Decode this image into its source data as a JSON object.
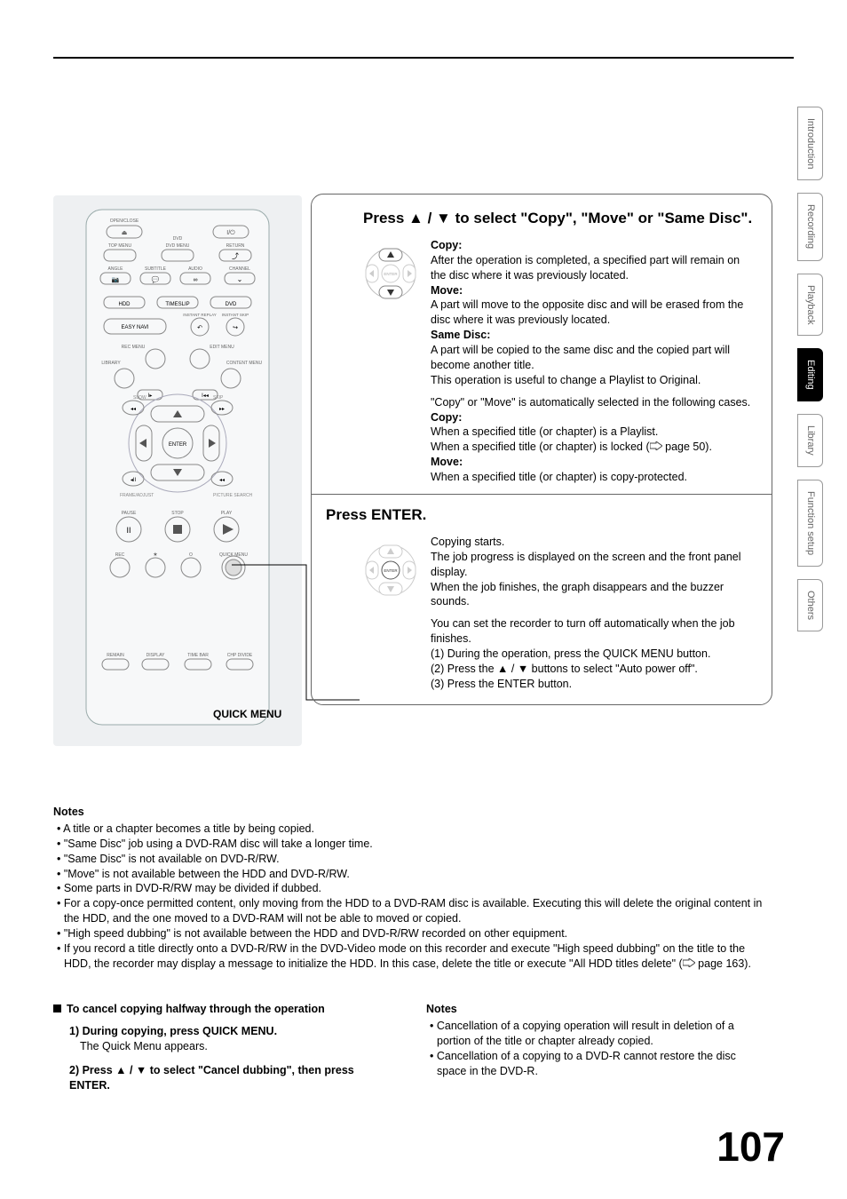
{
  "tabs": {
    "intro": "Introduction",
    "recording": "Recording",
    "playback": "Playback",
    "editing": "Editing",
    "library": "Library",
    "function": "Function setup",
    "others": "Others"
  },
  "remote": {
    "quick_menu_label": "QUICK MENU",
    "buttons": {
      "open_close": "OPEN/CLOSE",
      "power": "I/⏻",
      "top_menu": "TOP MENU",
      "dvd_menu": "DVD MENU",
      "return": "RETURN",
      "angle": "ANGLE",
      "subtitle": "SUBTITLE",
      "audio": "AUDIO",
      "channel": "CHANNEL",
      "hdd": "HDD",
      "timeslip": "TIMESLIP",
      "dvd": "DVD",
      "instant_replay": "INSTANT REPLAY",
      "instant_skip": "INSTANT SKIP",
      "easy_navi": "EASY NAVI",
      "rec_menu": "REC MENU",
      "edit_menu": "EDIT MENU",
      "library": "LIBRARY",
      "content_menu": "CONTENT MENU",
      "enter": "ENTER",
      "slow": "SLOW",
      "skip": "SKIP",
      "frame_adjust": "FRAME/ADJUST",
      "picture_search": "PICTURE SEARCH",
      "pause": "PAUSE",
      "stop": "STOP",
      "play": "PLAY",
      "rec": "REC",
      "star": "★",
      "o": "O",
      "quick_menu": "QUICK MENU",
      "remain": "REMAIN",
      "display": "DISPLAY",
      "time_bar": "TIME BAR",
      "chp_divide": "CHP DIVIDE"
    }
  },
  "step1": {
    "heading_pre": "Press ",
    "heading_mid": " / ",
    "heading_post": " to select \"Copy\", \"Move\" or \"Same Disc\".",
    "copy_lbl": "Copy:",
    "copy_txt": "After the operation is completed, a specified part will remain on the disc where it was previously located.",
    "move_lbl": "Move:",
    "move_txt": "A part will move to the opposite disc and will be erased from the disc where it was previously located.",
    "same_lbl": "Same Disc:",
    "same_txt1": "A part will be copied to the same disc and the copied part will become another title.",
    "same_txt2": "This operation is useful to change a Playlist to Original.",
    "auto_txt": "\"Copy\" or \"Move\" is automatically selected in the following cases.",
    "copy2_lbl": "Copy:",
    "copy2_l1": "When a specified title (or chapter) is a Playlist.",
    "copy2_l2_pre": "When a specified title (or chapter) is locked (",
    "copy2_l2_page": " page 50).",
    "move2_lbl": "Move:",
    "move2_txt": "When a specified title (or chapter) is copy-protected."
  },
  "step2": {
    "heading": "Press ENTER.",
    "p1": "Copying starts.",
    "p2": "The job progress is displayed on the screen and the front panel display.",
    "p3": "When the job finishes, the graph disappears and the buzzer sounds.",
    "p4": "You can set the recorder to turn off automatically when the job finishes.",
    "s1": "(1) During the operation, press the QUICK MENU button.",
    "s2_pre": "(2) Press the ",
    "s2_mid": " / ",
    "s2_post": " buttons to select \"Auto power off\".",
    "s3": "(3) Press the ENTER button."
  },
  "notes": {
    "heading": "Notes",
    "items": [
      "A title or a chapter becomes a title by being copied.",
      "\"Same Disc\" job using a DVD-RAM disc will take a longer time.",
      "\"Same Disc\" is not available on DVD-R/RW.",
      "\"Move\" is not available between the HDD and DVD-R/RW.",
      "Some parts in DVD-R/RW may be divided if dubbed.",
      "For a copy-once permitted content, only moving from the HDD to a DVD-RAM disc is available. Executing this will delete the original content in the HDD, and the one moved to a DVD-RAM will not be able to moved or copied.",
      "\"High speed dubbing\" is not available between the HDD and DVD-R/RW recorded on other equipment."
    ],
    "lastitem_pre": "If you record a title directly onto a DVD-R/RW in the DVD-Video mode on this recorder and execute \"High speed dubbing\" on the title to the HDD, the recorder may display a message to initialize the HDD. In this case, delete the title or execute \"All HDD titles delete\" (",
    "lastitem_page": " page 163)."
  },
  "cancel": {
    "heading": "To cancel copying halfway through the operation",
    "s1_bold": "During copying, press QUICK MENU.",
    "s1_body": "The Quick Menu appears.",
    "s2_pre": "Press ",
    "s2_mid": " / ",
    "s2_post": " to select \"Cancel dubbing\", then press ENTER."
  },
  "notes2": {
    "heading": "Notes",
    "items": [
      "Cancellation of a copying operation will result in deletion of a portion of the title or chapter already copied.",
      "Cancellation of a copying to a DVD-R cannot restore the disc space in the DVD-R."
    ]
  },
  "page_number": "107",
  "dpad_enter": "ENTER"
}
